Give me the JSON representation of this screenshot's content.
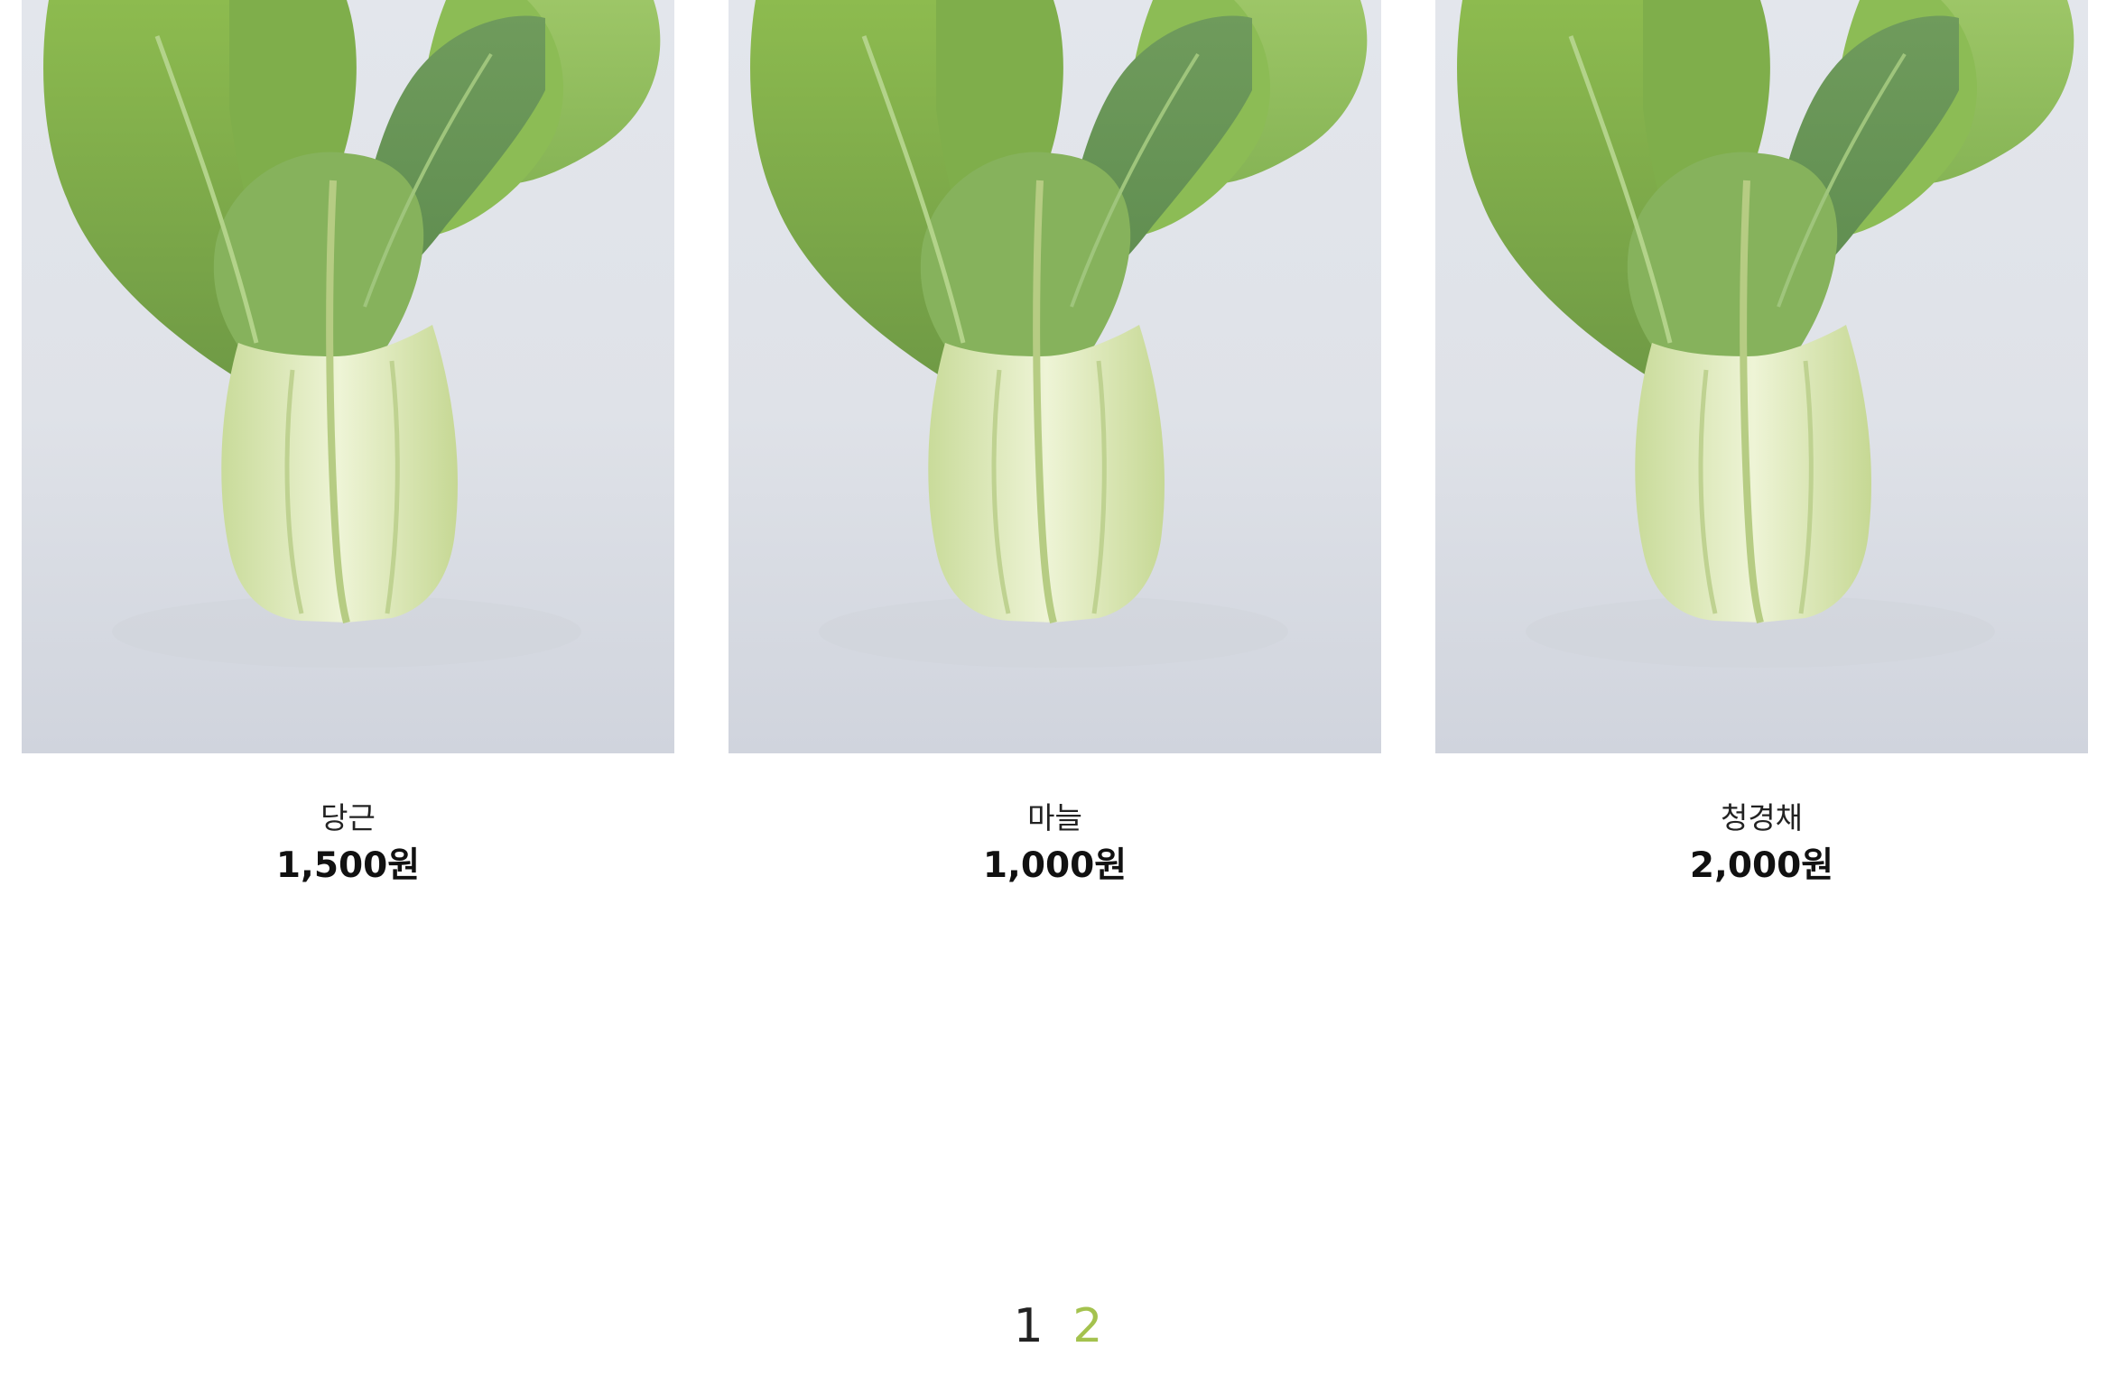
{
  "products": [
    {
      "name": "당근",
      "price": "1,500원",
      "image": "bok-choy-photo"
    },
    {
      "name": "마늘",
      "price": "1,000원",
      "image": "bok-choy-photo"
    },
    {
      "name": "청경채",
      "price": "2,000원",
      "image": "bok-choy-photo"
    }
  ],
  "pagination": {
    "pages": [
      "1",
      "2"
    ],
    "current": "2",
    "active_color": "#a4c24e"
  },
  "colors": {
    "leaf": "#7aa84a",
    "stem": "#d9e7b5",
    "background": "#d5d9e1"
  }
}
